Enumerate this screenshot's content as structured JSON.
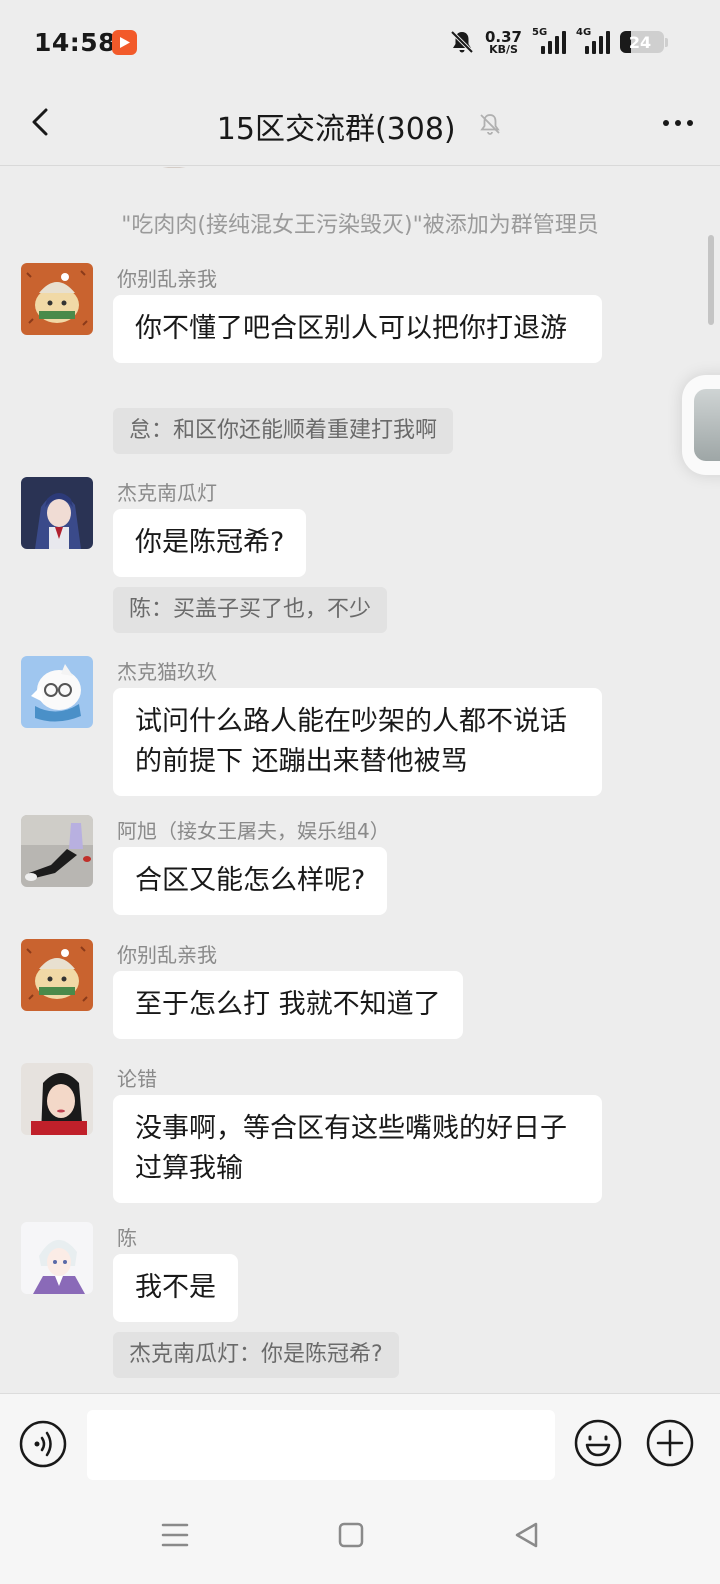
{
  "status_bar": {
    "time": "14:58",
    "speed_value": "0.37",
    "speed_unit": "KB/S",
    "net1": "5G",
    "net2": "4G",
    "battery": "24",
    "icons": [
      "video-app-icon",
      "bell-off-icon",
      "signal-icon",
      "battery-icon"
    ]
  },
  "header": {
    "title": "15区交流群(308)",
    "icons": [
      "back-chevron-icon",
      "bell-mute-icon",
      "more-dots-icon"
    ]
  },
  "chat": {
    "system_message": "\"吃肉肉(接纯混女王污染毁灭)\"被添加为群管理员",
    "messages": [
      {
        "sender": "你别乱亲我",
        "text": "你不懂了吧合区别人可以把你打退游",
        "quote": "怠：和区你还能顺着重建打我啊"
      },
      {
        "sender": "杰克南瓜灯",
        "text": "你是陈冠希?",
        "quote": "陈：买盖子买了也，不少"
      },
      {
        "sender": "杰克猫玖玖",
        "text": "试问什么路人能在吵架的人都不说话的前提下 还蹦出来替他被骂",
        "quote": ""
      },
      {
        "sender": "阿旭（接女王屠夫，娱乐组4）",
        "text": "合区又能怎么样呢?",
        "quote": ""
      },
      {
        "sender": "你别乱亲我",
        "text": "至于怎么打 我就不知道了",
        "quote": ""
      },
      {
        "sender": "论错",
        "text": "没事啊，等合区有这些嘴贱的好日子过算我输",
        "quote": ""
      },
      {
        "sender": "陈",
        "text": "我不是",
        "quote": "杰克南瓜灯：你是陈冠希?"
      }
    ]
  },
  "input_bar": {
    "value": "",
    "icons": [
      "voice-icon",
      "emoji-icon",
      "plus-icon"
    ]
  },
  "nav_bar": {
    "icons": [
      "menu-icon",
      "home-square-icon",
      "back-triangle-icon"
    ]
  },
  "colors": {
    "background": "#ededed",
    "bubble": "#ffffff",
    "quote": "#e2e2e2",
    "nickname": "#8a8a8a",
    "system_text": "#9a9a9a"
  }
}
